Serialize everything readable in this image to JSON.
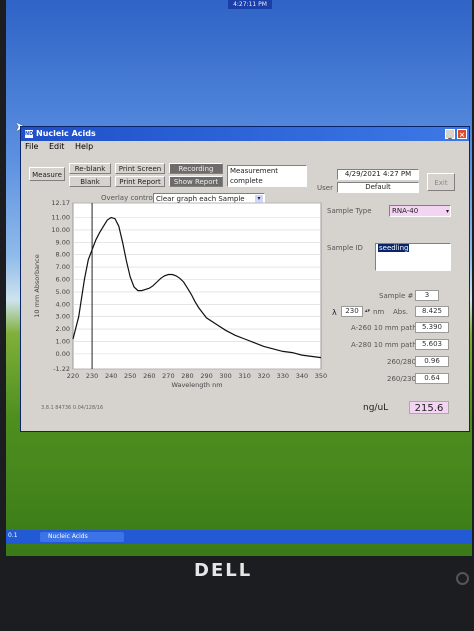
{
  "taskbar_clock": "4:27:11 PM",
  "window": {
    "title": "Nucleic Acids",
    "menu": [
      "File",
      "Edit",
      "Help"
    ]
  },
  "toolbar": {
    "measure": "Measure",
    "reblank": "Re-blank",
    "blank": "Blank",
    "print_screen": "Print Screen",
    "print_report": "Print Report",
    "recording": "Recording",
    "show_report": "Show Report",
    "status": "Measurement complete",
    "datetime": "4/29/2021 4:27 PM",
    "user_label": "User",
    "user_value": "Default",
    "exit": "Exit"
  },
  "overlay": {
    "label": "Overlay control",
    "selected": "Clear graph each Sample"
  },
  "sample": {
    "type_label": "Sample Type",
    "type_value": "RNA-40",
    "id_label": "Sample ID",
    "id_value": "seedling",
    "number_label": "Sample #",
    "number_value": "3",
    "lambda_label": "λ",
    "lambda_value": "230",
    "nm": "nm",
    "abs_label": "Abs.",
    "abs_value": "8.425",
    "a260_label": "A-260 10 mm path",
    "a260_value": "5.390",
    "a280_label": "A-280 10 mm path",
    "a280_value": "5.603",
    "r260_280_label": "260/280",
    "r260_280_value": "0.96",
    "r260_230_label": "260/230",
    "r260_230_value": "0.64",
    "conc_label": "ng/uL",
    "conc_value": "215.6"
  },
  "version": "3.8.1 84736 0.04/128/16",
  "taskbar_item": "Nucleic Acids",
  "taskbar_left": "0.1",
  "brand": "DELL",
  "chart_data": {
    "type": "line",
    "xlabel": "Wavelength nm",
    "ylabel": "10 mm Absorbance",
    "xlim": [
      220,
      350
    ],
    "ylim": [
      -1.22,
      12.17
    ],
    "xticks": [
      220,
      230,
      240,
      250,
      260,
      270,
      280,
      290,
      300,
      310,
      320,
      330,
      340,
      350
    ],
    "yticks": [
      "12.17",
      "11.00",
      "10.00",
      "9.00",
      "8.00",
      "7.00",
      "6.00",
      "5.00",
      "4.00",
      "3.00",
      "2.00",
      "1.00",
      "0.00",
      "-1.22"
    ],
    "marker_x": 230,
    "series": [
      {
        "x": [
          220,
          223,
          226,
          228,
          230,
          232,
          234,
          236,
          238,
          240,
          242,
          244,
          246,
          248,
          250,
          252,
          254,
          256,
          258,
          260,
          262,
          264,
          266,
          268,
          270,
          272,
          274,
          276,
          278,
          280,
          282,
          284,
          286,
          288,
          290,
          295,
          300,
          305,
          310,
          315,
          320,
          325,
          330,
          335,
          340,
          345,
          350
        ],
        "y": [
          1.2,
          3.0,
          6.0,
          7.6,
          8.4,
          9.2,
          9.8,
          10.3,
          10.8,
          11.0,
          10.9,
          10.3,
          9.0,
          7.5,
          6.2,
          5.4,
          5.1,
          5.1,
          5.2,
          5.3,
          5.5,
          5.8,
          6.1,
          6.3,
          6.4,
          6.4,
          6.3,
          6.1,
          5.8,
          5.3,
          4.8,
          4.2,
          3.7,
          3.3,
          2.9,
          2.4,
          1.9,
          1.5,
          1.2,
          0.9,
          0.6,
          0.4,
          0.2,
          0.1,
          -0.1,
          -0.2,
          -0.3
        ]
      }
    ]
  }
}
